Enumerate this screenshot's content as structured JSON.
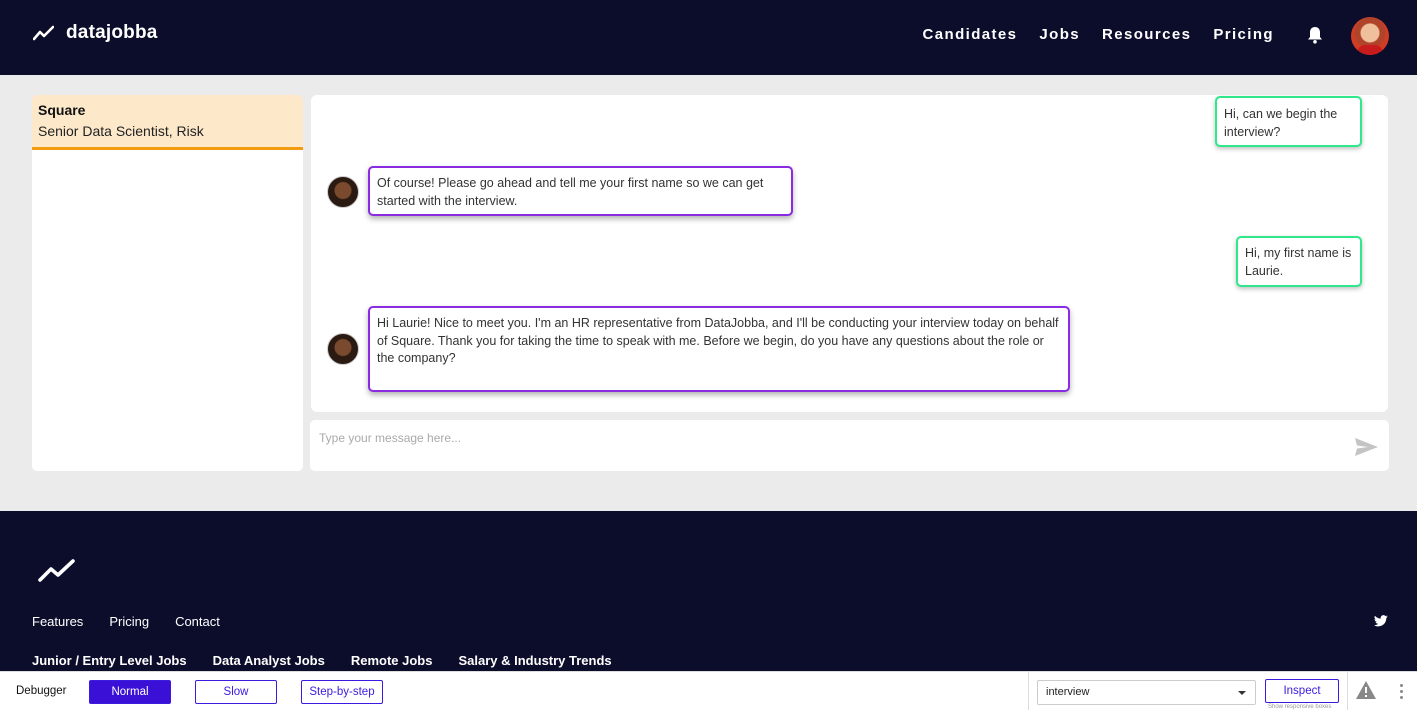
{
  "header": {
    "brand": "datajobba",
    "brand_icon": "trend-line-icon",
    "nav": [
      "Candidates",
      "Jobs",
      "Resources",
      "Pricing"
    ],
    "bell_icon": "bell-icon",
    "avatar": "user-avatar"
  },
  "sidebar": {
    "items": [
      {
        "company": "Square",
        "title": "Senior Data Scientist, Risk"
      }
    ]
  },
  "chat": {
    "messages": [
      {
        "from": "user",
        "text": "Hi, can we begin the interview?"
      },
      {
        "from": "bot",
        "text": "Of course! Please go ahead and tell me your first name so we can get started with the interview."
      },
      {
        "from": "user",
        "text": "Hi, my first name is Laurie."
      },
      {
        "from": "bot",
        "text": "Hi Laurie! Nice to meet you. I'm an HR representative from DataJobba, and I'll be conducting your interview today on behalf of Square. Thank you for taking the time to speak with me. Before we begin, do you have any questions about the role or the company?"
      }
    ],
    "input_placeholder": "Type your message here...",
    "send_icon": "send-icon"
  },
  "footer": {
    "links": [
      "Features",
      "Pricing",
      "Contact"
    ],
    "job_links": [
      "Junior / Entry Level Jobs",
      "Data Analyst Jobs",
      "Remote Jobs",
      "Salary & Industry Trends"
    ],
    "social_icon": "twitter-icon"
  },
  "debugger": {
    "label": "Debugger",
    "modes": [
      "Normal",
      "Slow",
      "Step-by-step"
    ],
    "active_mode": "Normal",
    "select_value": "interview",
    "inspect_label": "Inspect",
    "inspect_hint": "Show responsive boxes"
  },
  "colors": {
    "navy": "#0b0d2b",
    "user_bubble_border": "#2ee88a",
    "bot_bubble_border": "#8a2be2",
    "active_job_bg": "#fde9ca",
    "active_job_border": "#f39c12",
    "debugger_accent": "#3a0fd6"
  }
}
